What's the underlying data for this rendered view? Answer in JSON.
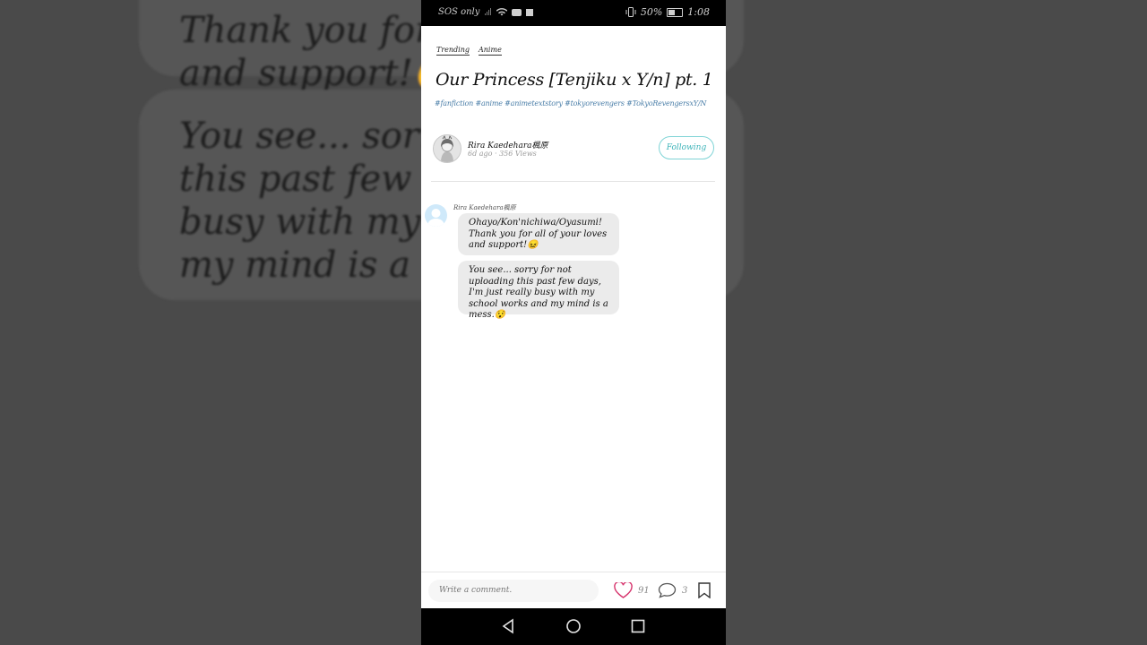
{
  "background": {
    "bubble1_lines": [
      "Thank you for a",
      "and support!😖"
    ],
    "bubble2_lines": [
      "You see... sorry",
      "this past few da",
      "busy with my sc",
      "my mind is a me"
    ]
  },
  "statusbar": {
    "left_text": "SOS only",
    "battery": "50%",
    "time": "1:08"
  },
  "post": {
    "tags": [
      "Trending",
      "Anime"
    ],
    "title": "Our Princess [Tenjiku x Y/n] pt. 1",
    "hashtags": "#fanfiction #anime #animetextstory #tokyorevengers #TokyoRevengersxY/N"
  },
  "author": {
    "name": "Rira Kaedehara楓原",
    "meta": "6d ago · 356 Views",
    "follow_label": "Following"
  },
  "chat": {
    "sender": "Rira Kaedehara楓原",
    "messages": [
      "Ohayo/Kon'nichiwa/Oyasumi! Thank you for all of your loves and support!😖",
      "You see... sorry for not uploading this past few days, I'm just really busy with my school works and my mind is a mess.😯"
    ]
  },
  "actions": {
    "comment_placeholder": "Write a comment.",
    "likes": "91",
    "comments": "3"
  },
  "colors": {
    "accent": "#3bb3b8",
    "like": "#d6336c",
    "hashtag": "#4a7ea8"
  },
  "icons": [
    "wifi-icon",
    "signal-icon",
    "youtube-icon",
    "vibrate-icon",
    "battery-icon",
    "heart-icon",
    "comment-icon",
    "bookmark-icon",
    "back-icon",
    "home-icon",
    "recents-icon"
  ]
}
